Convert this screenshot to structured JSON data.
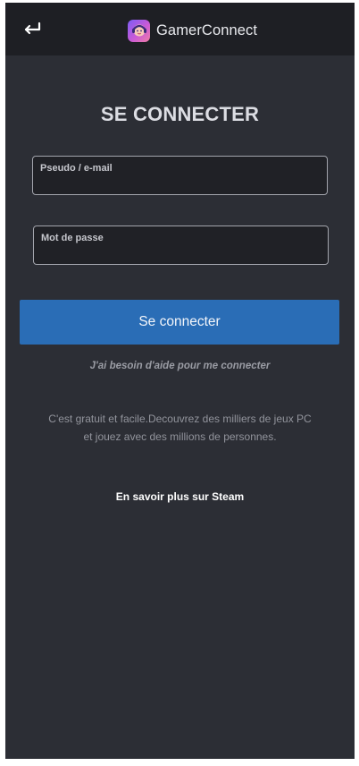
{
  "header": {
    "app_name": "GamerConnect",
    "back_icon": "return-arrow-icon",
    "logo_icon": "gamer-avatar-icon"
  },
  "login": {
    "title": "SE CONNECTER",
    "username_label": "Pseudo / e-mail",
    "username_value": "",
    "password_label": "Mot de passe",
    "password_value": "",
    "submit_label": "Se connecter",
    "help_link": "J'ai besoin d'aide pour me connecter"
  },
  "promo": {
    "text": "C'est gratuit et facile.Decouvrez des milliers de jeux PC et jouez avec des millions de personnes.",
    "steam_link": "En savoir plus sur Steam"
  },
  "colors": {
    "background": "#2c2e35",
    "header": "#1e1f24",
    "accent": "#2a6db6",
    "field_border": "#a3a5ad"
  }
}
